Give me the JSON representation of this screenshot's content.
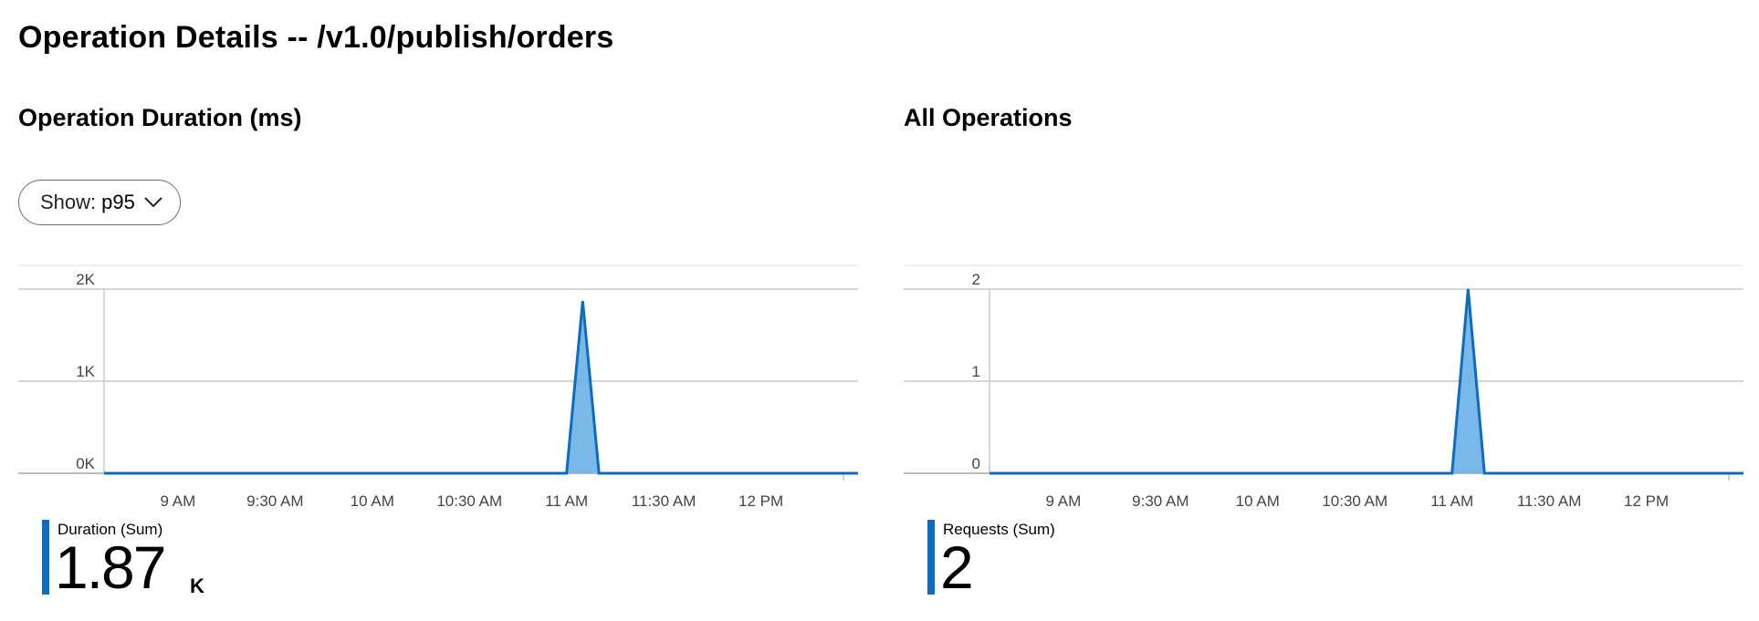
{
  "page": {
    "title": "Operation Details -- /v1.0/publish/orders"
  },
  "left_panel": {
    "title": "Operation Duration (ms)",
    "dropdown": {
      "prefix": "Show:",
      "value": "p95"
    },
    "metric": {
      "label": "Duration (Sum)",
      "value": "1.87",
      "unit": "K"
    }
  },
  "right_panel": {
    "title": "All Operations",
    "metric": {
      "label": "Requests (Sum)",
      "value": "2",
      "unit": ""
    }
  },
  "colors": {
    "series_line": "#0f6cbd",
    "series_fill": "#6bb0e8",
    "gridline": "#c8c8c8",
    "accent_bar": "#0f6cbd"
  },
  "chart_data": [
    {
      "type": "area",
      "title": "Operation Duration (ms)",
      "y_ticks": [
        "0K",
        "1K",
        "2K"
      ],
      "ylim": [
        0,
        2000
      ],
      "x_ticks": [
        "9 AM",
        "9:30 AM",
        "10 AM",
        "10:30 AM",
        "11 AM",
        "11:30 AM",
        "12 PM"
      ],
      "x_tick_hours": [
        9,
        9.5,
        10,
        10.5,
        11,
        11.5,
        12
      ],
      "xlim_hours": [
        8.62,
        12.5
      ],
      "series": [
        {
          "name": "Duration (Sum)",
          "x_hours": [
            8.62,
            11.0,
            11.083,
            11.167,
            12.5
          ],
          "values": [
            0,
            0,
            1870,
            0,
            0
          ]
        }
      ],
      "grid": true
    },
    {
      "type": "area",
      "title": "All Operations",
      "y_ticks": [
        "0",
        "1",
        "2"
      ],
      "ylim": [
        0,
        2
      ],
      "x_ticks": [
        "9 AM",
        "9:30 AM",
        "10 AM",
        "10:30 AM",
        "11 AM",
        "11:30 AM",
        "12 PM"
      ],
      "x_tick_hours": [
        9,
        9.5,
        10,
        10.5,
        11,
        11.5,
        12
      ],
      "xlim_hours": [
        8.62,
        12.5
      ],
      "series": [
        {
          "name": "Requests (Sum)",
          "x_hours": [
            8.62,
            11.0,
            11.083,
            11.167,
            12.5
          ],
          "values": [
            0,
            0,
            2,
            0,
            0
          ]
        }
      ],
      "grid": true
    }
  ]
}
